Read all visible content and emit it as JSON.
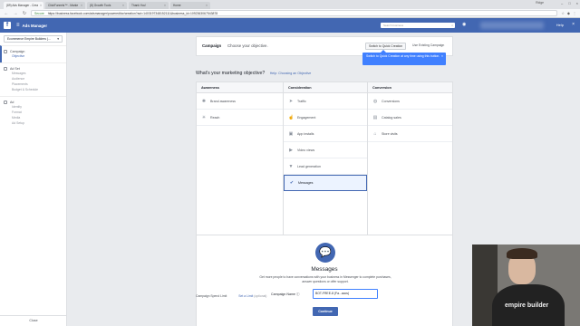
{
  "browser": {
    "tabs": [
      {
        "label": "(89) Ads Manager - Crea",
        "active": true
      },
      {
        "label": "ClickFunnels™ - Marke",
        "active": false
      },
      {
        "label": "(8) Growth Tools",
        "active": false
      },
      {
        "label": "Thank You!",
        "active": false
      },
      {
        "label": "Home",
        "active": false
      }
    ],
    "user": "Ridge",
    "secure_label": "Secure",
    "url": "https://business.facebook.com/adsmanager/powereditor/creation?act=1403197348152111&business_id=1092363067543878"
  },
  "header": {
    "app_name": "Ads Manager",
    "search_placeholder": "Search business",
    "help": "Help",
    "brand_color": "#4267b2"
  },
  "sidebar": {
    "account": "Ecommerce Empire Builders (...",
    "sections": [
      {
        "label": "Campaign",
        "items": [
          "Objective"
        ]
      },
      {
        "label": "Ad Set",
        "items": [
          "Messages",
          "Audience",
          "Placements",
          "Budget & Schedule"
        ]
      },
      {
        "label": "Ad",
        "items": [
          "Identity",
          "Format",
          "Media",
          "Ad Setup"
        ]
      }
    ],
    "close": "Close"
  },
  "topcard": {
    "title": "Campaign",
    "subtitle": "Choose your objective.",
    "quick_button": "Switch to Quick Creation",
    "existing": "Use Existing Campaign"
  },
  "tooltip": "Switch to Quick Creation at any time using this button.",
  "question": {
    "text": "What's your marketing objective?",
    "help": "Help: Choosing an Objective"
  },
  "objectives": {
    "awareness": {
      "heading": "Awareness",
      "options": [
        "Brand awareness",
        "Reach"
      ]
    },
    "consideration": {
      "heading": "Consideration",
      "options": [
        "Traffic",
        "Engagement",
        "App installs",
        "Video views",
        "Lead generation",
        "Messages"
      ]
    },
    "conversion": {
      "heading": "Conversion",
      "options": [
        "Conversions",
        "Catalog sales",
        "Store visits"
      ]
    },
    "selected": "Messages"
  },
  "messages_panel": {
    "title": "Messages",
    "description": "Get more people to have conversations with your business in Messenger to complete purchases, answer questions or offer support.",
    "name_label": "Campaign Name",
    "name_value": "BOT-FREE-8 (Fa...acos)",
    "continue": "Continue"
  },
  "bottombar": {
    "spend": "Campaign Spend Limit",
    "set_limit": "Set a Limit",
    "optional": "(optional)"
  },
  "webcam": {
    "shirt_text": "empire builder"
  }
}
